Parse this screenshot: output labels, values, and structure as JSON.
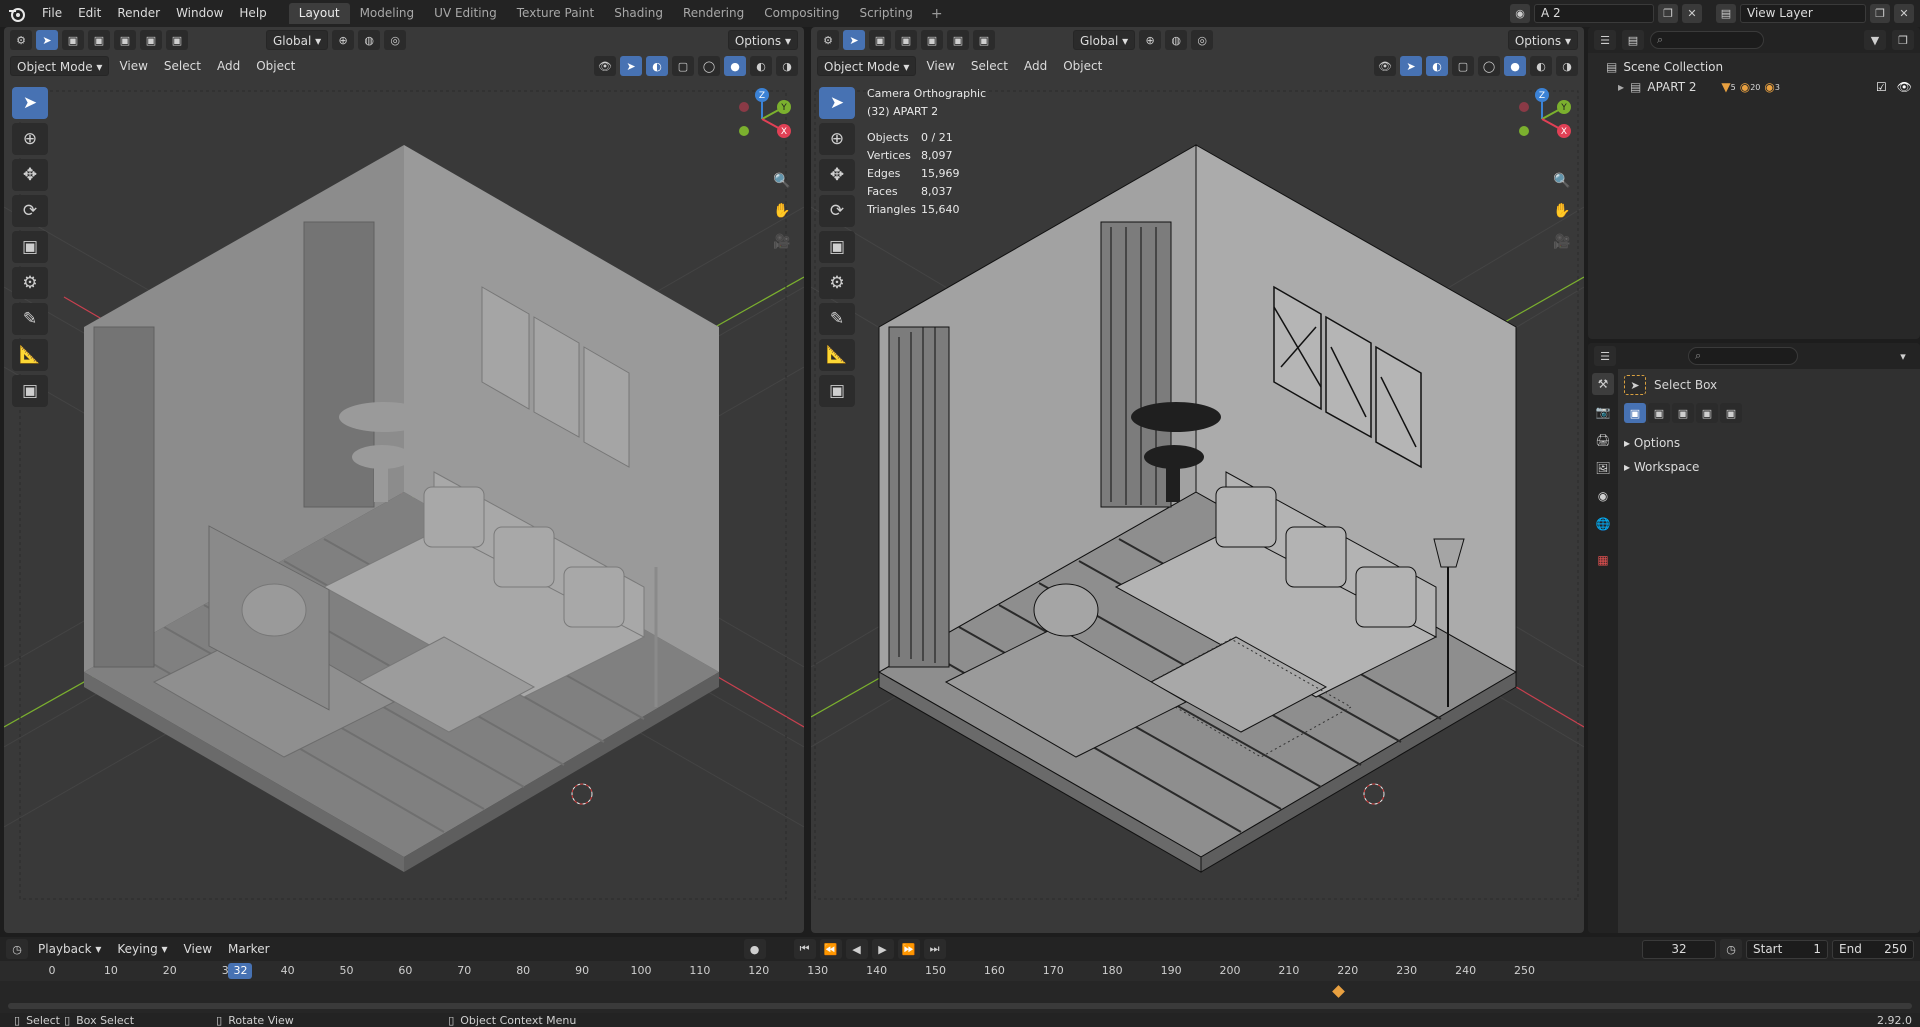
{
  "menu": [
    "File",
    "Edit",
    "Render",
    "Window",
    "Help"
  ],
  "workspaces": [
    "Layout",
    "Modeling",
    "UV Editing",
    "Texture Paint",
    "Shading",
    "Rendering",
    "Compositing",
    "Scripting"
  ],
  "scene_name": "A 2",
  "view_layer": "View Layer",
  "viewport_left": {
    "mode": "Object Mode",
    "menus": [
      "View",
      "Select",
      "Add",
      "Object"
    ],
    "transform_orientation": "Global",
    "options_label": "Options"
  },
  "viewport_right": {
    "mode": "Object Mode",
    "menus": [
      "View",
      "Select",
      "Add",
      "Object"
    ],
    "transform_orientation": "Global",
    "options_label": "Options",
    "camera_label": "Camera Orthographic",
    "collection_label": "(32) APART 2",
    "stats": [
      {
        "key": "Objects",
        "value": "0 / 21"
      },
      {
        "key": "Vertices",
        "value": "8,097"
      },
      {
        "key": "Edges",
        "value": "15,969"
      },
      {
        "key": "Faces",
        "value": "8,037"
      },
      {
        "key": "Triangles",
        "value": "15,640"
      }
    ]
  },
  "gizmo_axes": {
    "x": "X",
    "y": "Y",
    "z": "Z"
  },
  "outliner": {
    "root": "Scene Collection",
    "items": [
      {
        "name": "APART 2",
        "count1": "5",
        "count2": "20",
        "count3": "3"
      }
    ]
  },
  "properties": {
    "tool_name": "Select Box",
    "panels": [
      "Options",
      "Workspace"
    ]
  },
  "timeline": {
    "menus": [
      "Playback",
      "Keying",
      "View",
      "Marker"
    ],
    "current_frame": "32",
    "start_label": "Start",
    "start_value": "1",
    "end_label": "End",
    "end_value": "250",
    "ruler": [
      "0",
      "10",
      "20",
      "30",
      "40",
      "50",
      "60",
      "70",
      "80",
      "90",
      "100",
      "110",
      "120",
      "130",
      "140",
      "150",
      "160",
      "170",
      "180",
      "190",
      "200",
      "210",
      "220",
      "230",
      "240",
      "250"
    ],
    "playhead": "32"
  },
  "statusbar": {
    "select": "Select",
    "box_select": "Box Select",
    "rotate_view": "Rotate View",
    "context_menu": "Object Context Menu",
    "version": "2.92.0"
  },
  "colors": {
    "accent": "#4772b3",
    "axis_x": "#e04055",
    "axis_y": "#7bb02e",
    "axis_z": "#3b82d6",
    "viewport_bg": "#393939"
  }
}
